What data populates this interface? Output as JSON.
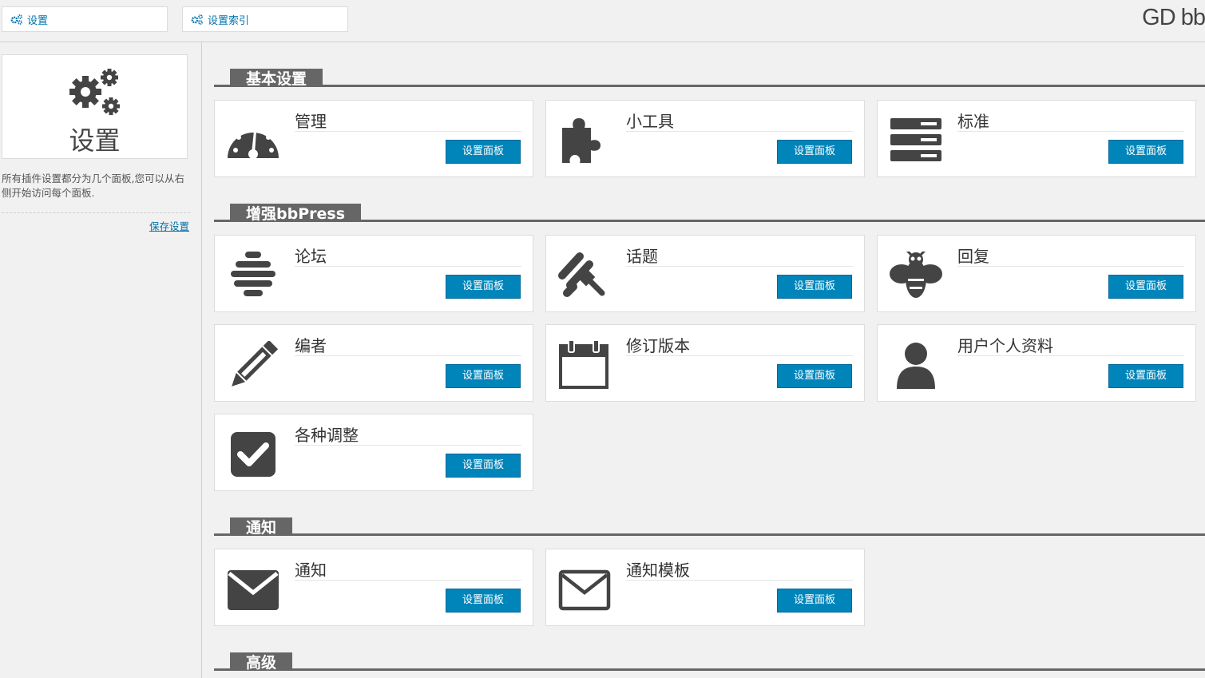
{
  "topbar": {
    "tabs": [
      {
        "label": "设置",
        "icon": "gears-icon"
      },
      {
        "label": "设置索引",
        "icon": "gears-icon"
      }
    ],
    "brand": "GD bb"
  },
  "sidebar": {
    "title": "设置",
    "icon": "gears-icon",
    "description": "所有插件设置都分为几个面板,您可以从右侧开始访问每个面板.",
    "save_link": "保存设置"
  },
  "sections": [
    {
      "title": "基本设置",
      "cards": [
        {
          "title": "管理",
          "icon": "dashboard-gauge-icon",
          "button": "设置面板"
        },
        {
          "title": "小工具",
          "icon": "puzzle-piece-icon",
          "button": "设置面板"
        },
        {
          "title": "标准",
          "icon": "server-stack-icon",
          "button": "设置面板"
        }
      ]
    },
    {
      "title": "增强bbPress",
      "cards": [
        {
          "title": "论坛",
          "icon": "beehive-icon",
          "button": "设置面板"
        },
        {
          "title": "话题",
          "icon": "honey-dipper-icon",
          "button": "设置面板"
        },
        {
          "title": "回复",
          "icon": "bee-icon",
          "button": "设置面板"
        },
        {
          "title": "编者",
          "icon": "pencil-icon",
          "button": "设置面板"
        },
        {
          "title": "修订版本",
          "icon": "calendar-icon",
          "button": "设置面板"
        },
        {
          "title": "用户个人资料",
          "icon": "user-icon",
          "button": "设置面板"
        },
        {
          "title": "各种调整",
          "icon": "checkbox-checked-icon",
          "button": "设置面板"
        }
      ]
    },
    {
      "title": "通知",
      "cards": [
        {
          "title": "通知",
          "icon": "envelope-solid-icon",
          "button": "设置面板"
        },
        {
          "title": "通知模板",
          "icon": "envelope-outline-icon",
          "button": "设置面板"
        }
      ]
    },
    {
      "title": "高级",
      "cards": []
    }
  ],
  "colors": {
    "accent_button": "#0085ba",
    "section_tab": "#666666",
    "link": "#0073aa",
    "icon": "#444444"
  }
}
